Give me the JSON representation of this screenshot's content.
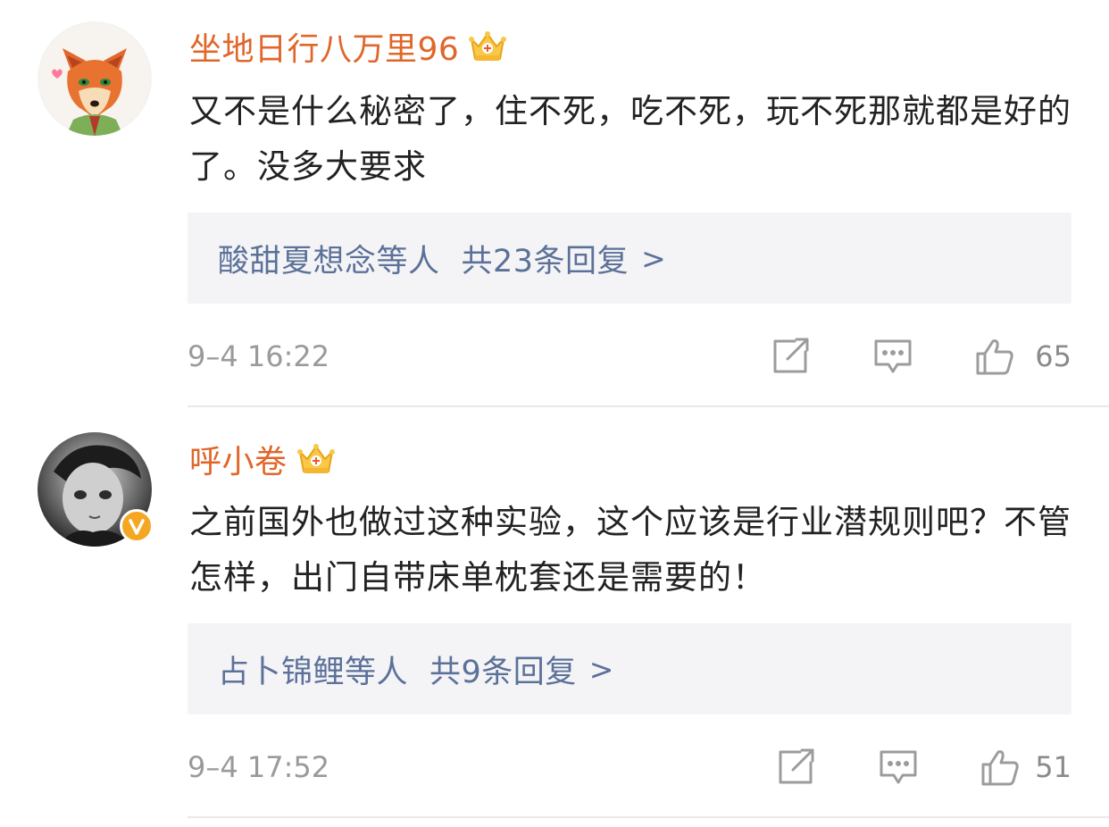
{
  "comments": [
    {
      "username": "坐地日行八万里96",
      "avatar": "fox-avatar",
      "badge": "crown-icon",
      "content": "又不是什么秘密了，住不死，吃不死，玩不死那就都是好的了。没多大要求",
      "replies": {
        "users": "酸甜夏想念等人",
        "count_label": "共23条回复",
        "chevron": ">"
      },
      "timestamp": "9–4 16:22",
      "likes": "65",
      "verified": false
    },
    {
      "username": "呼小卷",
      "avatar": "child-avatar",
      "badge": "crown-icon",
      "content": "之前国外也做过这种实验，这个应该是行业潜规则吧？不管怎样，出门自带床单枕套还是需要的！",
      "replies": {
        "users": "占卜锦鲤等人",
        "count_label": "共9条回复",
        "chevron": ">"
      },
      "timestamp": "9–4 17:52",
      "likes": "51",
      "verified": true
    }
  ],
  "colors": {
    "username": "#e0662a",
    "reply_link": "#5c7199",
    "meta": "#9a9a9a",
    "reply_bg": "#f4f4f6",
    "verified_badge": "#f5a623"
  }
}
